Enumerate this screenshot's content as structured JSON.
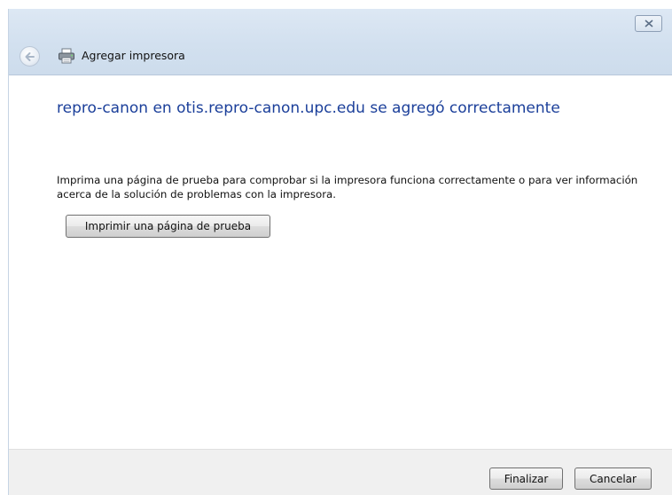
{
  "window": {
    "title": "Agregar impresora",
    "close_symbol": "✕"
  },
  "main": {
    "heading": "repro-canon en otis.repro-canon.upc.edu se agregó correctamente",
    "description": "Imprima una página de prueba para comprobar si la impresora funciona correctamente o para ver información acerca de la solución de problemas con la impresora.",
    "test_page_button": "Imprimir una página de prueba"
  },
  "footer": {
    "finish_label": "Finalizar",
    "cancel_label": "Cancelar"
  },
  "icons": {
    "back": "back-arrow-icon",
    "printer": "printer-icon",
    "close": "close-icon"
  },
  "colors": {
    "heading": "#1b3f9a",
    "titlebar": "#d2e0ef",
    "footer": "#f0f0f0"
  }
}
